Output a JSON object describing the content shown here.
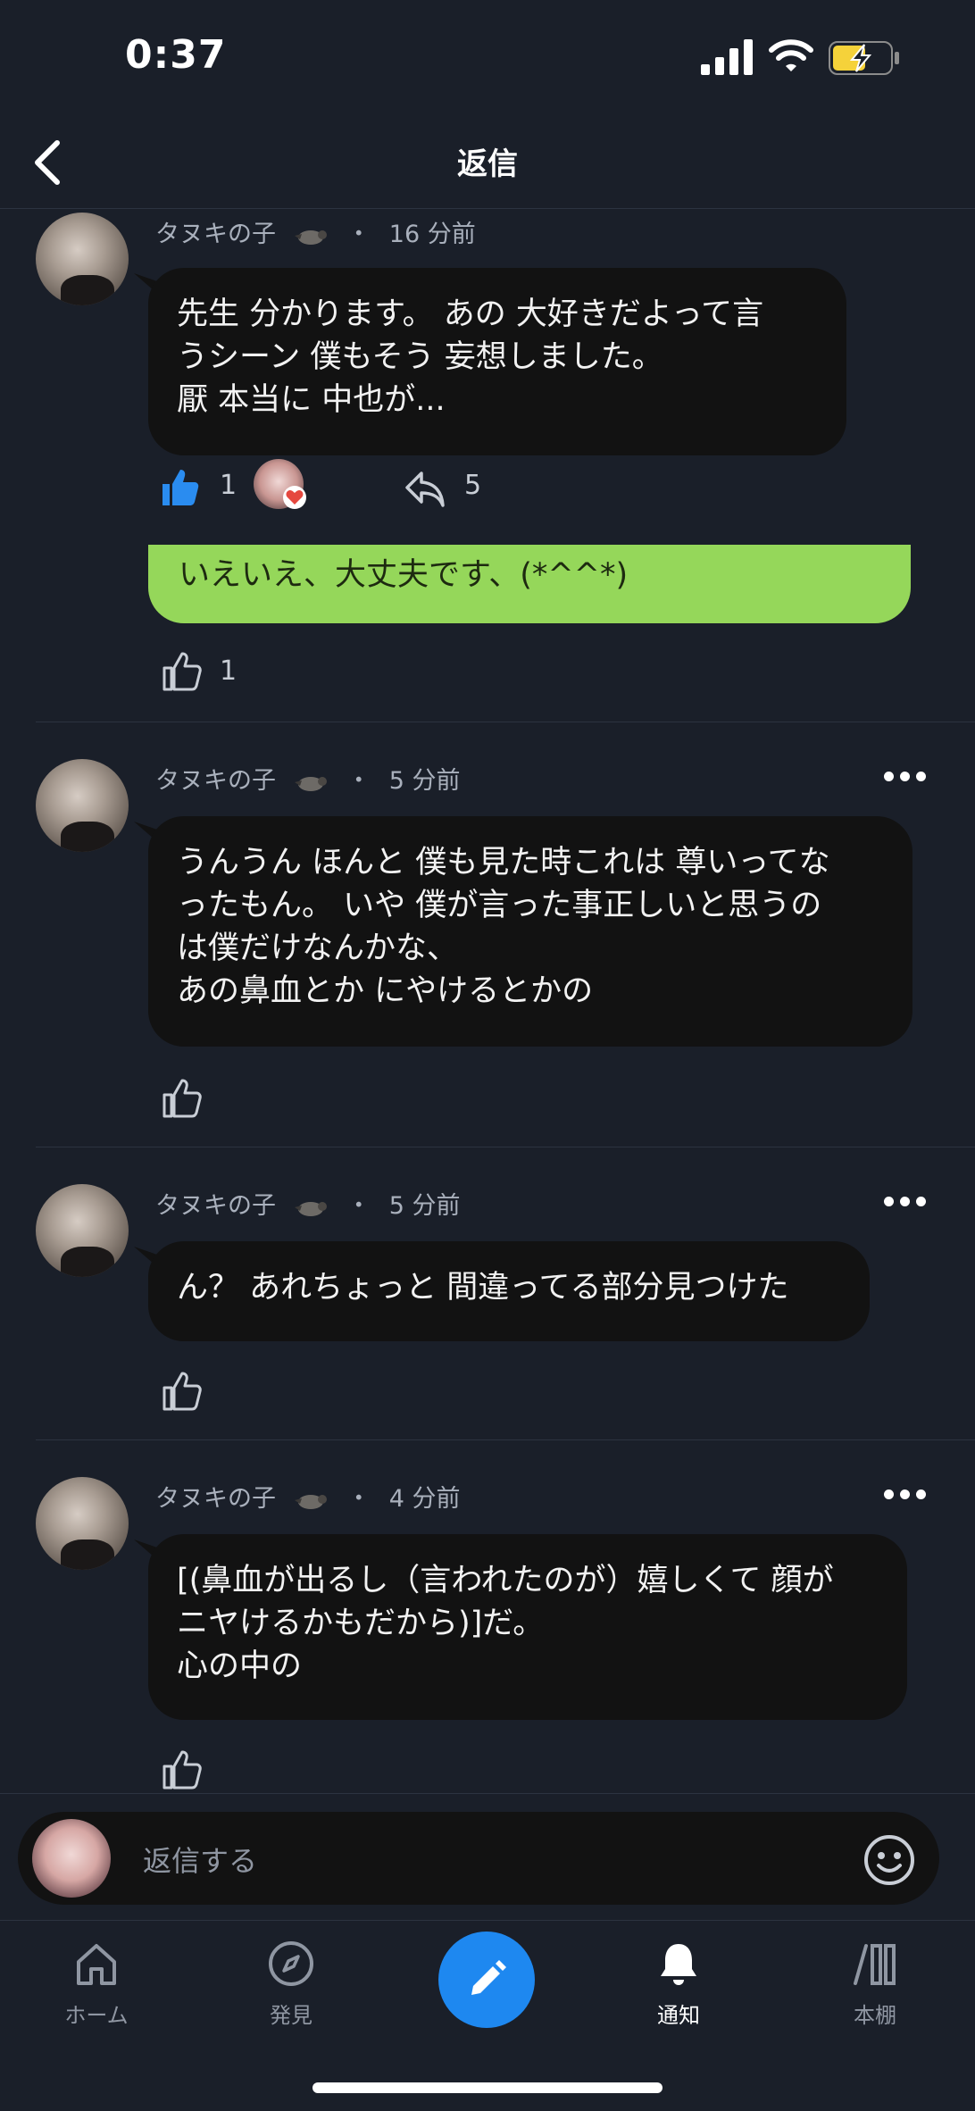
{
  "status_bar": {
    "time": "0:37"
  },
  "header": {
    "title": "返信"
  },
  "pinned_comment": {
    "author": "タヌキの子",
    "separator": "・",
    "time": "16 分前",
    "text": "先生 分かります。 あの 大好きだよって言\nうシーン 僕もそう 妄想しました。\n厭 本当に 中也が...",
    "like_count": "1",
    "reply_count": "5"
  },
  "green_reply": {
    "text": "いえいえ、大丈夫です、(*^^*)",
    "like_count": "1"
  },
  "comments": [
    {
      "author": "タヌキの子",
      "separator": "・",
      "time": "5 分前",
      "text": "うんうん ほんと 僕も見た時これは 尊いってな\nったもん。 いや 僕が言った事正しいと思うの\nは僕だけなんかな、\nあの鼻血とか にやけるとかの"
    },
    {
      "author": "タヌキの子",
      "separator": "・",
      "time": "5 分前",
      "text": "ん？ あれちょっと 間違ってる部分見つけた"
    },
    {
      "author": "タヌキの子",
      "separator": "・",
      "time": "4 分前",
      "text": "[(鼻血が出るし（言われたのが）嬉しくて 顔が\nニヤけるかもだから)]だ。\n心の中の"
    }
  ],
  "reply_input": {
    "placeholder": "返信する"
  },
  "tabs": [
    {
      "label": "ホーム",
      "icon": "home-icon"
    },
    {
      "label": "発見",
      "icon": "compass-icon"
    },
    {
      "label": "",
      "icon": "pencil-icon"
    },
    {
      "label": "通知",
      "icon": "bell-icon"
    },
    {
      "label": "本棚",
      "icon": "bookshelf-icon"
    }
  ],
  "colors": {
    "accent": "#1e88f0",
    "green_bubble": "#95d75a",
    "background": "#1a1f29",
    "bubble": "#121212"
  }
}
